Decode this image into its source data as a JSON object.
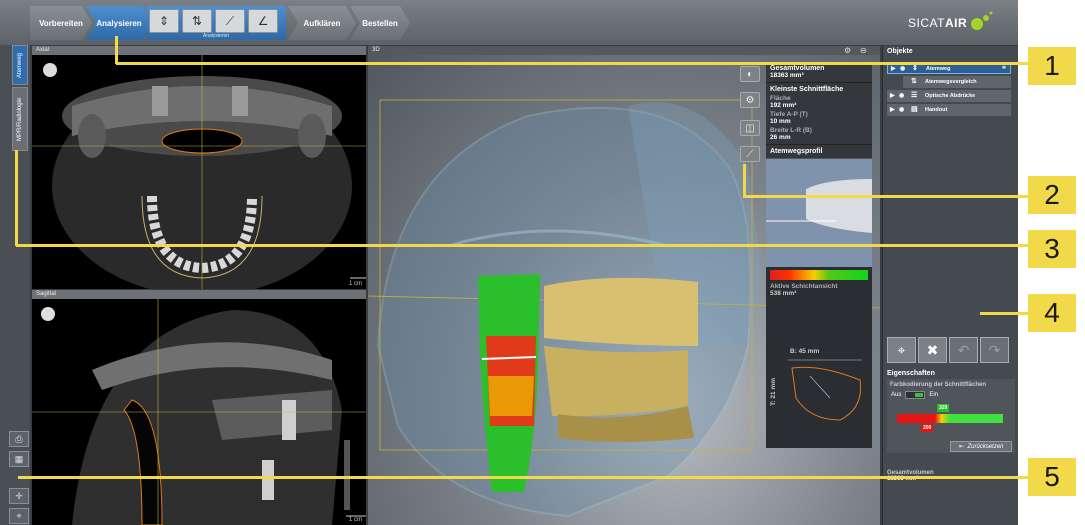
{
  "workflow": {
    "steps": [
      {
        "label": "Vorbereiten"
      },
      {
        "label": "Analysieren"
      },
      {
        "label": "Aufklären"
      },
      {
        "label": "Bestellen"
      }
    ],
    "analyze_group_label": "Analysieren",
    "tools": [
      "airway-region-icon",
      "airway-compare-icon",
      "measure-distance-icon",
      "measure-angle-icon"
    ]
  },
  "logo": {
    "text_light": "SICAT",
    "text_bold": "AIR"
  },
  "left_tabs": {
    "airway": "Atemweg",
    "mpr": "MPR/Radiologie"
  },
  "views": {
    "axial": {
      "title": "Axial",
      "scale": "1 cm"
    },
    "sagittal": {
      "title": "Sagittal",
      "scale": "1 cm"
    },
    "threeD": {
      "title": "3D"
    }
  },
  "info": {
    "total_volume_label": "Gesamtvolumen",
    "total_volume_value": "18363 mm³",
    "min_section_label": "Kleinste Schnittfläche",
    "area_label": "Fläche",
    "area_value": "192 mm²",
    "depth_label": "Tiefe A-P (T)",
    "depth_value": "10 mm",
    "width_label": "Breite L-R (B)",
    "width_value": "26 mm",
    "profile_label": "Atemwegsprofil",
    "active_slice_label": "Aktive Schichtansicht",
    "active_slice_value": "538 mm²",
    "b_value": "B: 45 mm",
    "t_value": "T: 21 mm"
  },
  "objects": {
    "title": "Objekte",
    "items": [
      {
        "label": "Atemweg"
      },
      {
        "label": "Atemwegsvergleich"
      },
      {
        "label": "Optische Abdrücke"
      },
      {
        "label": "Handout"
      }
    ]
  },
  "properties": {
    "title": "Eigenschaften",
    "color_coding_label": "Farbkodierung der Schnittflächen",
    "off_label": "Aus",
    "on_label": "Ein",
    "upper_marker": "320",
    "lower_marker": "200",
    "reset_label": "Zurücksetzen",
    "total_volume_label": "Gesamtvolumen",
    "total_volume_value": "18363 mm³"
  },
  "callouts": [
    "1",
    "2",
    "3",
    "4",
    "5"
  ],
  "colors": {
    "accent": "#2d69a8",
    "callout": "#f2d94a",
    "panel": "#454a50"
  }
}
